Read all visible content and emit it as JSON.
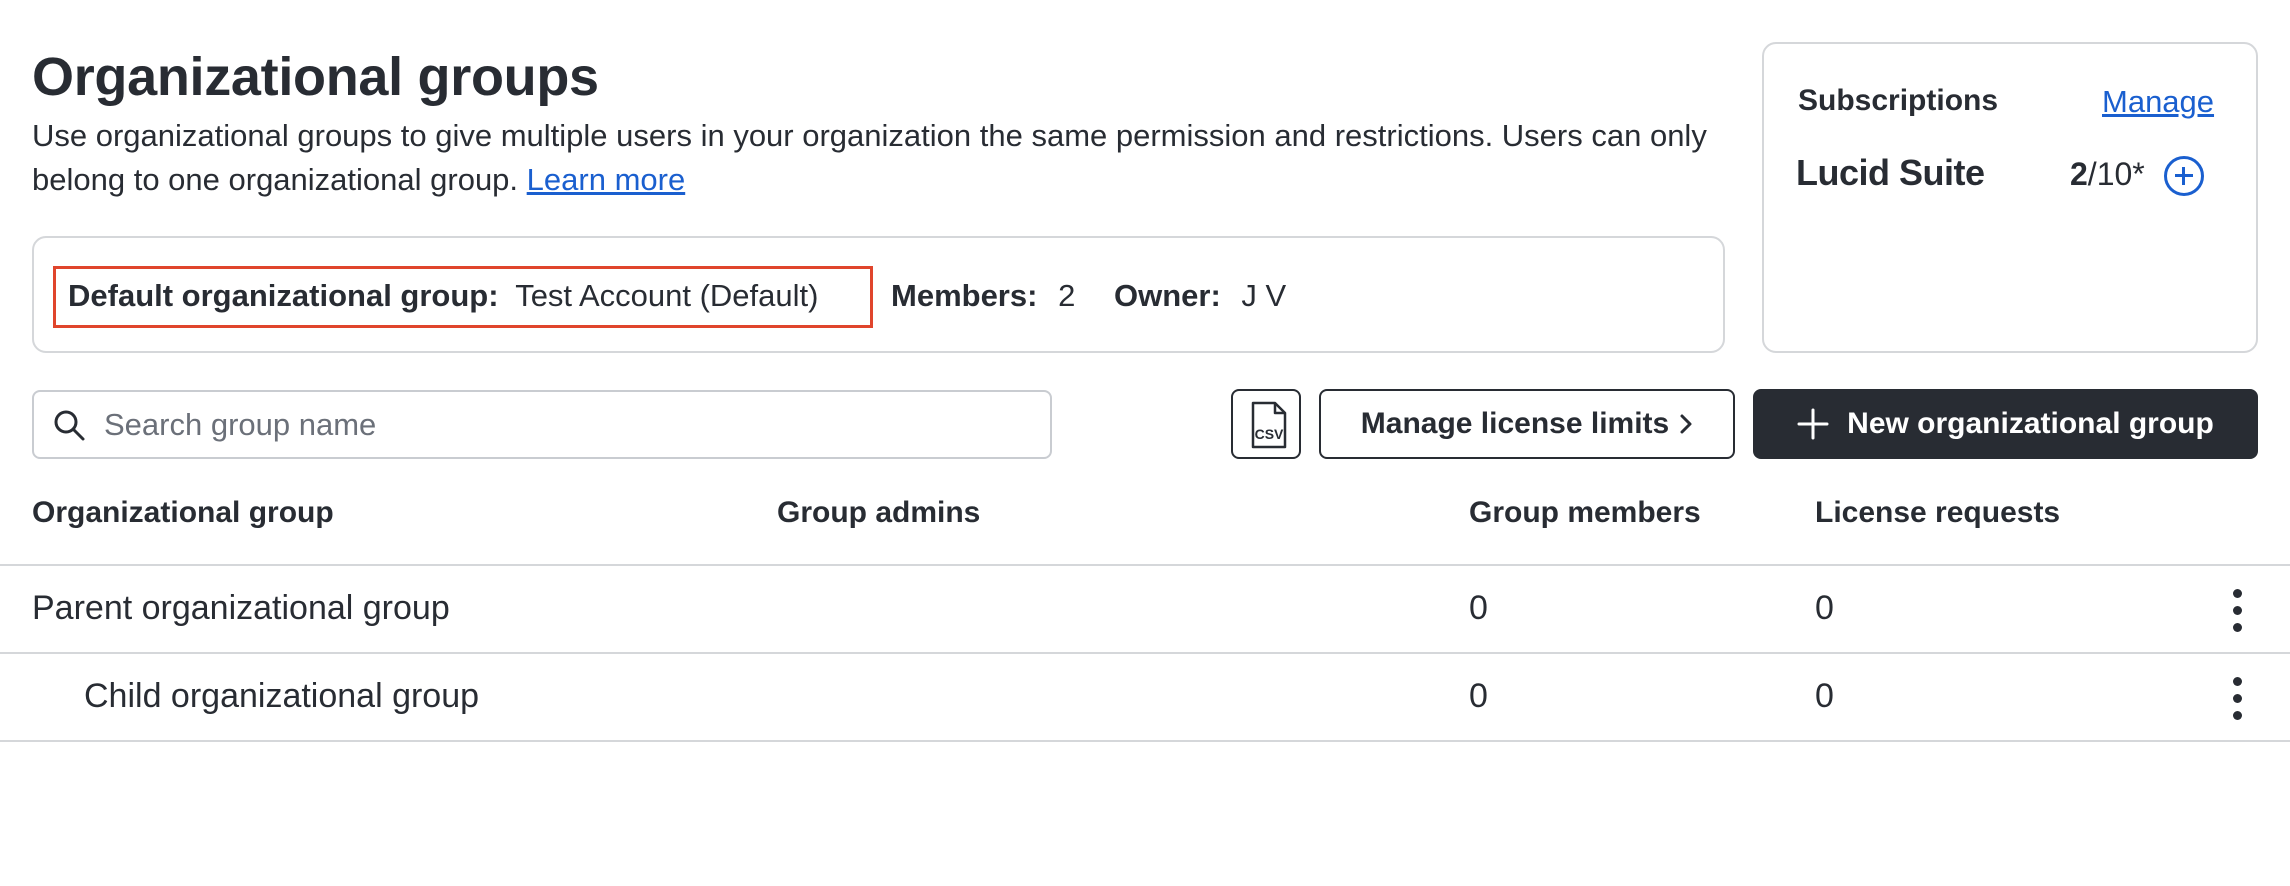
{
  "page": {
    "title": "Organizational groups",
    "description": "Use organizational groups to give multiple users in your organization the same permission and restrictions. Users can only belong to one organizational group.",
    "learn_more": "Learn more"
  },
  "default_group": {
    "label": "Default organizational group:",
    "value": "Test Account (Default)",
    "members_label": "Members:",
    "members_value": "2",
    "owner_label": "Owner:",
    "owner_value": "J V"
  },
  "subscriptions": {
    "title": "Subscriptions",
    "manage": "Manage",
    "product": "Lucid Suite",
    "used": "2",
    "total": "/10*"
  },
  "toolbar": {
    "search_placeholder": "Search group name",
    "csv_label": "CSV",
    "manage_limits": "Manage license limits",
    "new_group": "New organizational group"
  },
  "table": {
    "headers": [
      "Organizational group",
      "Group admins",
      "Group members",
      "License requests"
    ],
    "rows": [
      {
        "name": "Parent organizational group",
        "admins": "",
        "members": "0",
        "requests": "0"
      },
      {
        "name": "Child organizational group",
        "admins": "",
        "members": "0",
        "requests": "0"
      }
    ]
  },
  "colors": {
    "accent": "#1a5fcf",
    "dark": "#282c33",
    "highlight": "#e0452c",
    "border": "#d5d7da"
  }
}
